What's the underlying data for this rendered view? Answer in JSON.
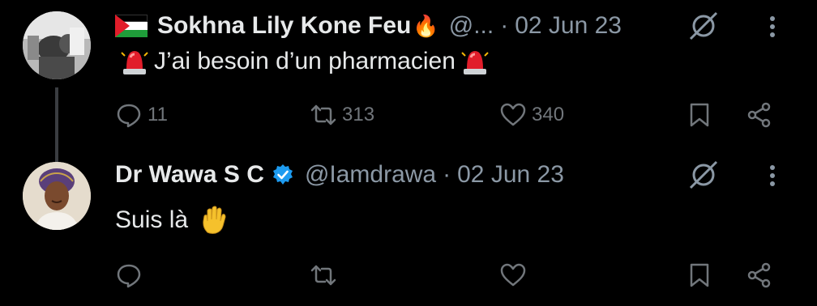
{
  "tweets": [
    {
      "author_name": "Sokhna Lily Kone Feu",
      "name_emoji": "🔥",
      "handle": "@...",
      "separator": "·",
      "date": "02 Jun 23",
      "text": "J’ai besoin d’un pharmacien",
      "replies": "11",
      "retweets": "313",
      "likes": "340",
      "icons": [
        "reply-icon",
        "retweet-icon",
        "like-icon",
        "bookmark-icon",
        "share-icon"
      ]
    },
    {
      "author_name": "Dr Wawa S C",
      "handle": "@Iamdrawa",
      "separator": "·",
      "date": "02 Jun 23",
      "text": "Suis là",
      "replies": "",
      "retweets": "",
      "likes": "",
      "icons": [
        "reply-icon",
        "retweet-icon",
        "like-icon",
        "bookmark-icon",
        "share-icon"
      ]
    }
  ],
  "colors": {
    "background": "#000000",
    "text": "#e7e9ea",
    "muted": "#71767b",
    "verified": "#1d9bf0"
  }
}
